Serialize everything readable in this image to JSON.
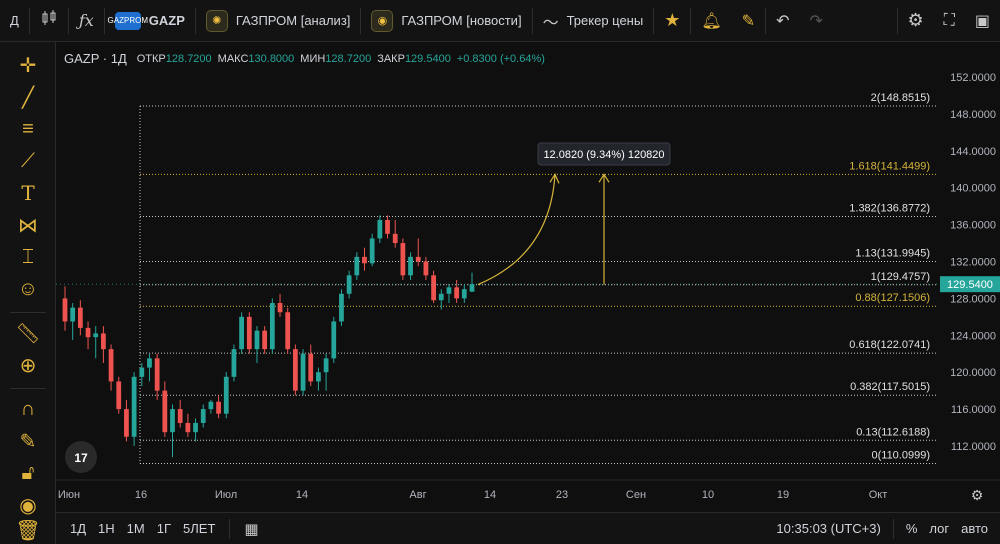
{
  "topbar": {
    "menu_label": "Д",
    "symbol": "GAZP",
    "symbol_logo_text": "GAZPROM",
    "analysis_tab": "ГАЗПРОМ [анализ]",
    "news_tab": "ГАЗПРОМ [новости]",
    "tracker_label": "Трекер цены"
  },
  "header": {
    "title": "GAZP · 1Д",
    "open_label": "ОТКР",
    "open_value": "128.7200",
    "high_label": "МАКС",
    "high_value": "130.8000",
    "low_label": "МИН",
    "low_value": "128.7200",
    "close_label": "ЗАКР",
    "close_value": "129.5400",
    "change_value": "+0.8300 (+0.64%)"
  },
  "measure_label": "12.0820 (9.34%) 120820",
  "current_price_label": "129.5400",
  "colors": {
    "up": "#26a69a",
    "down": "#ef5350",
    "fib_gold": "#d4b43a",
    "grid_text": "#b2b5be",
    "price_tag": "#26a69a"
  },
  "bottombar": {
    "ranges": [
      "1Д",
      "1Н",
      "1М",
      "1Г",
      "5ЛЕТ"
    ],
    "time": "10:35:03 (UTC+3)",
    "percent": "%",
    "log": "лог",
    "auto": "авто"
  },
  "chart_data": {
    "type": "candlestick",
    "title": "GAZP · 1Д",
    "ylim": [
      109.0,
      153.0
    ],
    "y_ticks": [
      "152.0000",
      "148.0000",
      "144.0000",
      "140.0000",
      "136.0000",
      "132.0000",
      "128.0000",
      "124.0000",
      "120.0000",
      "116.0000",
      "112.0000"
    ],
    "y_tick_values": [
      152,
      148,
      144,
      140,
      136,
      132,
      128,
      124,
      120,
      116,
      112
    ],
    "x_ticks": [
      "Июн",
      "16",
      "Июл",
      "14",
      "Авг",
      "14",
      "23",
      "Сен",
      "10",
      "19",
      "Окт"
    ],
    "fib_levels": [
      {
        "label": "2(148.8515)",
        "value": 148.8515,
        "highlight": false
      },
      {
        "label": "1.618(141.4499)",
        "value": 141.4499,
        "highlight": true
      },
      {
        "label": "1.382(136.8772)",
        "value": 136.8772,
        "highlight": false
      },
      {
        "label": "1.13(131.9945)",
        "value": 131.9945,
        "highlight": false
      },
      {
        "label": "1(129.4757)",
        "value": 129.4757,
        "highlight": false
      },
      {
        "label": "0.88(127.1506)",
        "value": 127.1506,
        "highlight": true
      },
      {
        "label": "0.618(122.0741)",
        "value": 122.0741,
        "highlight": false
      },
      {
        "label": "0.382(117.5015)",
        "value": 117.5015,
        "highlight": false
      },
      {
        "label": "0.13(112.6188)",
        "value": 112.6188,
        "highlight": false
      },
      {
        "label": "0(110.0999)",
        "value": 110.0999,
        "highlight": false
      }
    ],
    "candles": [
      [
        128.0,
        129.3,
        124.5,
        125.5
      ],
      [
        125.5,
        127.5,
        123.5,
        127.0
      ],
      [
        127.0,
        127.8,
        124.0,
        124.8
      ],
      [
        124.8,
        125.5,
        122.5,
        123.8
      ],
      [
        123.8,
        125.0,
        121.5,
        124.2
      ],
      [
        124.2,
        125.0,
        121.0,
        122.5
      ],
      [
        122.5,
        123.0,
        118.0,
        119.0
      ],
      [
        119.0,
        119.5,
        115.5,
        116.0
      ],
      [
        116.0,
        117.0,
        112.5,
        113.0
      ],
      [
        113.0,
        120.0,
        112.0,
        119.5
      ],
      [
        119.5,
        121.0,
        118.5,
        120.5
      ],
      [
        120.5,
        122.0,
        119.0,
        121.5
      ],
      [
        121.5,
        122.0,
        117.0,
        118.0
      ],
      [
        118.0,
        119.0,
        113.0,
        113.5
      ],
      [
        113.5,
        116.5,
        110.8,
        116.0
      ],
      [
        116.0,
        117.0,
        114.0,
        114.5
      ],
      [
        114.5,
        115.5,
        113.0,
        113.5
      ],
      [
        113.5,
        115.0,
        112.5,
        114.5
      ],
      [
        114.5,
        116.5,
        114.0,
        116.0
      ],
      [
        116.0,
        117.0,
        115.5,
        116.8
      ],
      [
        116.8,
        117.5,
        115.0,
        115.5
      ],
      [
        115.5,
        120.0,
        115.0,
        119.5
      ],
      [
        119.5,
        123.0,
        119.0,
        122.5
      ],
      [
        122.5,
        126.5,
        122.0,
        126.0
      ],
      [
        126.0,
        126.5,
        122.0,
        122.5
      ],
      [
        122.5,
        125.0,
        121.0,
        124.5
      ],
      [
        124.5,
        125.0,
        122.0,
        122.5
      ],
      [
        122.5,
        128.0,
        122.0,
        127.5
      ],
      [
        127.5,
        128.5,
        126.0,
        126.5
      ],
      [
        126.5,
        127.0,
        122.0,
        122.5
      ],
      [
        122.5,
        123.0,
        117.5,
        118.0
      ],
      [
        118.0,
        122.5,
        117.5,
        122.0
      ],
      [
        122.0,
        123.0,
        118.5,
        119.0
      ],
      [
        119.0,
        120.5,
        118.0,
        120.0
      ],
      [
        120.0,
        122.0,
        118.0,
        121.5
      ],
      [
        121.5,
        126.0,
        121.0,
        125.5
      ],
      [
        125.5,
        129.0,
        125.0,
        128.5
      ],
      [
        128.5,
        131.0,
        128.0,
        130.5
      ],
      [
        130.5,
        133.0,
        130.0,
        132.5
      ],
      [
        132.5,
        133.5,
        131.0,
        131.8
      ],
      [
        131.8,
        135.0,
        131.5,
        134.5
      ],
      [
        134.5,
        137.0,
        134.0,
        136.5
      ],
      [
        136.5,
        137.0,
        134.5,
        135.0
      ],
      [
        135.0,
        136.5,
        133.5,
        134.0
      ],
      [
        134.0,
        134.5,
        130.0,
        130.5
      ],
      [
        130.5,
        133.0,
        130.0,
        132.5
      ],
      [
        132.5,
        134.5,
        131.5,
        132.0
      ],
      [
        132.0,
        132.5,
        130.0,
        130.5
      ],
      [
        130.5,
        131.0,
        127.5,
        127.8
      ],
      [
        127.8,
        129.0,
        126.8,
        128.5
      ],
      [
        128.5,
        129.5,
        127.5,
        129.2
      ],
      [
        129.2,
        130.0,
        127.5,
        128.0
      ],
      [
        128.0,
        129.5,
        127.5,
        129.0
      ],
      [
        128.72,
        130.8,
        128.72,
        129.54
      ]
    ]
  }
}
